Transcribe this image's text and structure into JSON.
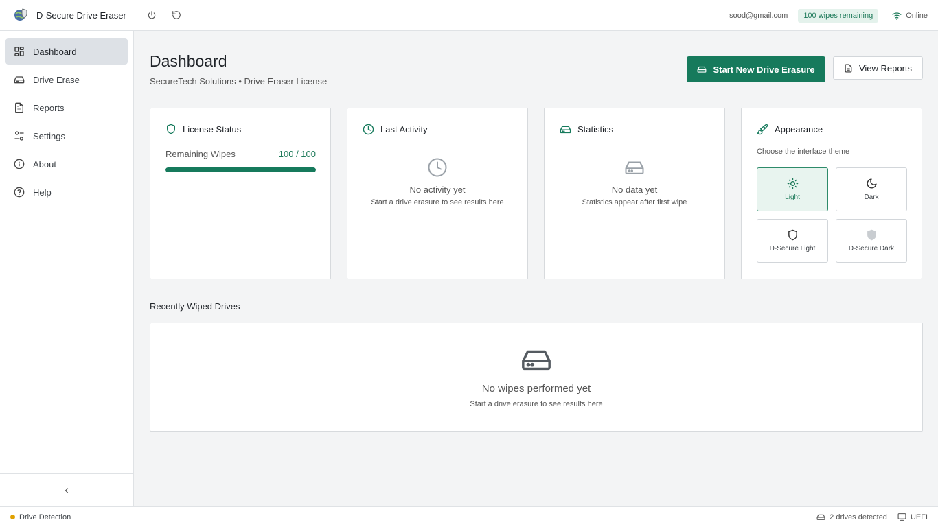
{
  "app": {
    "title": "D-Secure Drive Eraser",
    "logo_icon": "globe-shield-logo",
    "power_icon": "power-icon",
    "refresh_icon": "refresh-icon"
  },
  "header": {
    "email": "sood@gmail.com",
    "wipes_badge": "100 wipes remaining",
    "status": "Online"
  },
  "sidebar": {
    "items": [
      {
        "label": "Dashboard",
        "icon": "dashboard-icon",
        "active": true
      },
      {
        "label": "Drive Erase",
        "icon": "drive-icon",
        "active": false
      },
      {
        "label": "Reports",
        "icon": "document-icon",
        "active": false
      },
      {
        "label": "Settings",
        "icon": "sliders-icon",
        "active": false
      },
      {
        "label": "About",
        "icon": "info-icon",
        "active": false
      },
      {
        "label": "Help",
        "icon": "help-icon",
        "active": false
      }
    ],
    "collapse_icon": "chevron-left-icon"
  },
  "main": {
    "title": "Dashboard",
    "subtitle": "SecureTech Solutions • Drive Eraser License",
    "primary_button": "Start New Drive Erasure",
    "secondary_button": "View Reports"
  },
  "license": {
    "title": "License Status",
    "label": "Remaining Wipes",
    "count": "100 / 100",
    "remaining": 100,
    "total": 100
  },
  "activity": {
    "title": "Last Activity",
    "empty_title": "No activity yet",
    "empty_sub": "Start a drive erasure to see results here"
  },
  "statistics": {
    "title": "Statistics",
    "empty_title": "No data yet",
    "empty_sub": "Statistics appear after first wipe"
  },
  "appearance": {
    "title": "Appearance",
    "description": "Choose the interface theme",
    "themes": [
      {
        "label": "Light",
        "icon": "sun-icon",
        "selected": true
      },
      {
        "label": "Dark",
        "icon": "moon-icon",
        "selected": false
      },
      {
        "label": "D-Secure Light",
        "icon": "shield-outline-icon",
        "selected": false
      },
      {
        "label": "D-Secure Dark",
        "icon": "shield-filled-icon",
        "selected": false
      }
    ]
  },
  "recent": {
    "title": "Recently Wiped Drives",
    "empty_title": "No wipes performed yet",
    "empty_sub": "Start a drive erasure to see results here"
  },
  "statusbar": {
    "left": "Drive Detection",
    "drives": "2 drives detected",
    "boot": "UEFI"
  },
  "colors": {
    "accent": "#167a5c",
    "badge_bg": "#e4f2ec",
    "status_dot": "#e0a100"
  }
}
